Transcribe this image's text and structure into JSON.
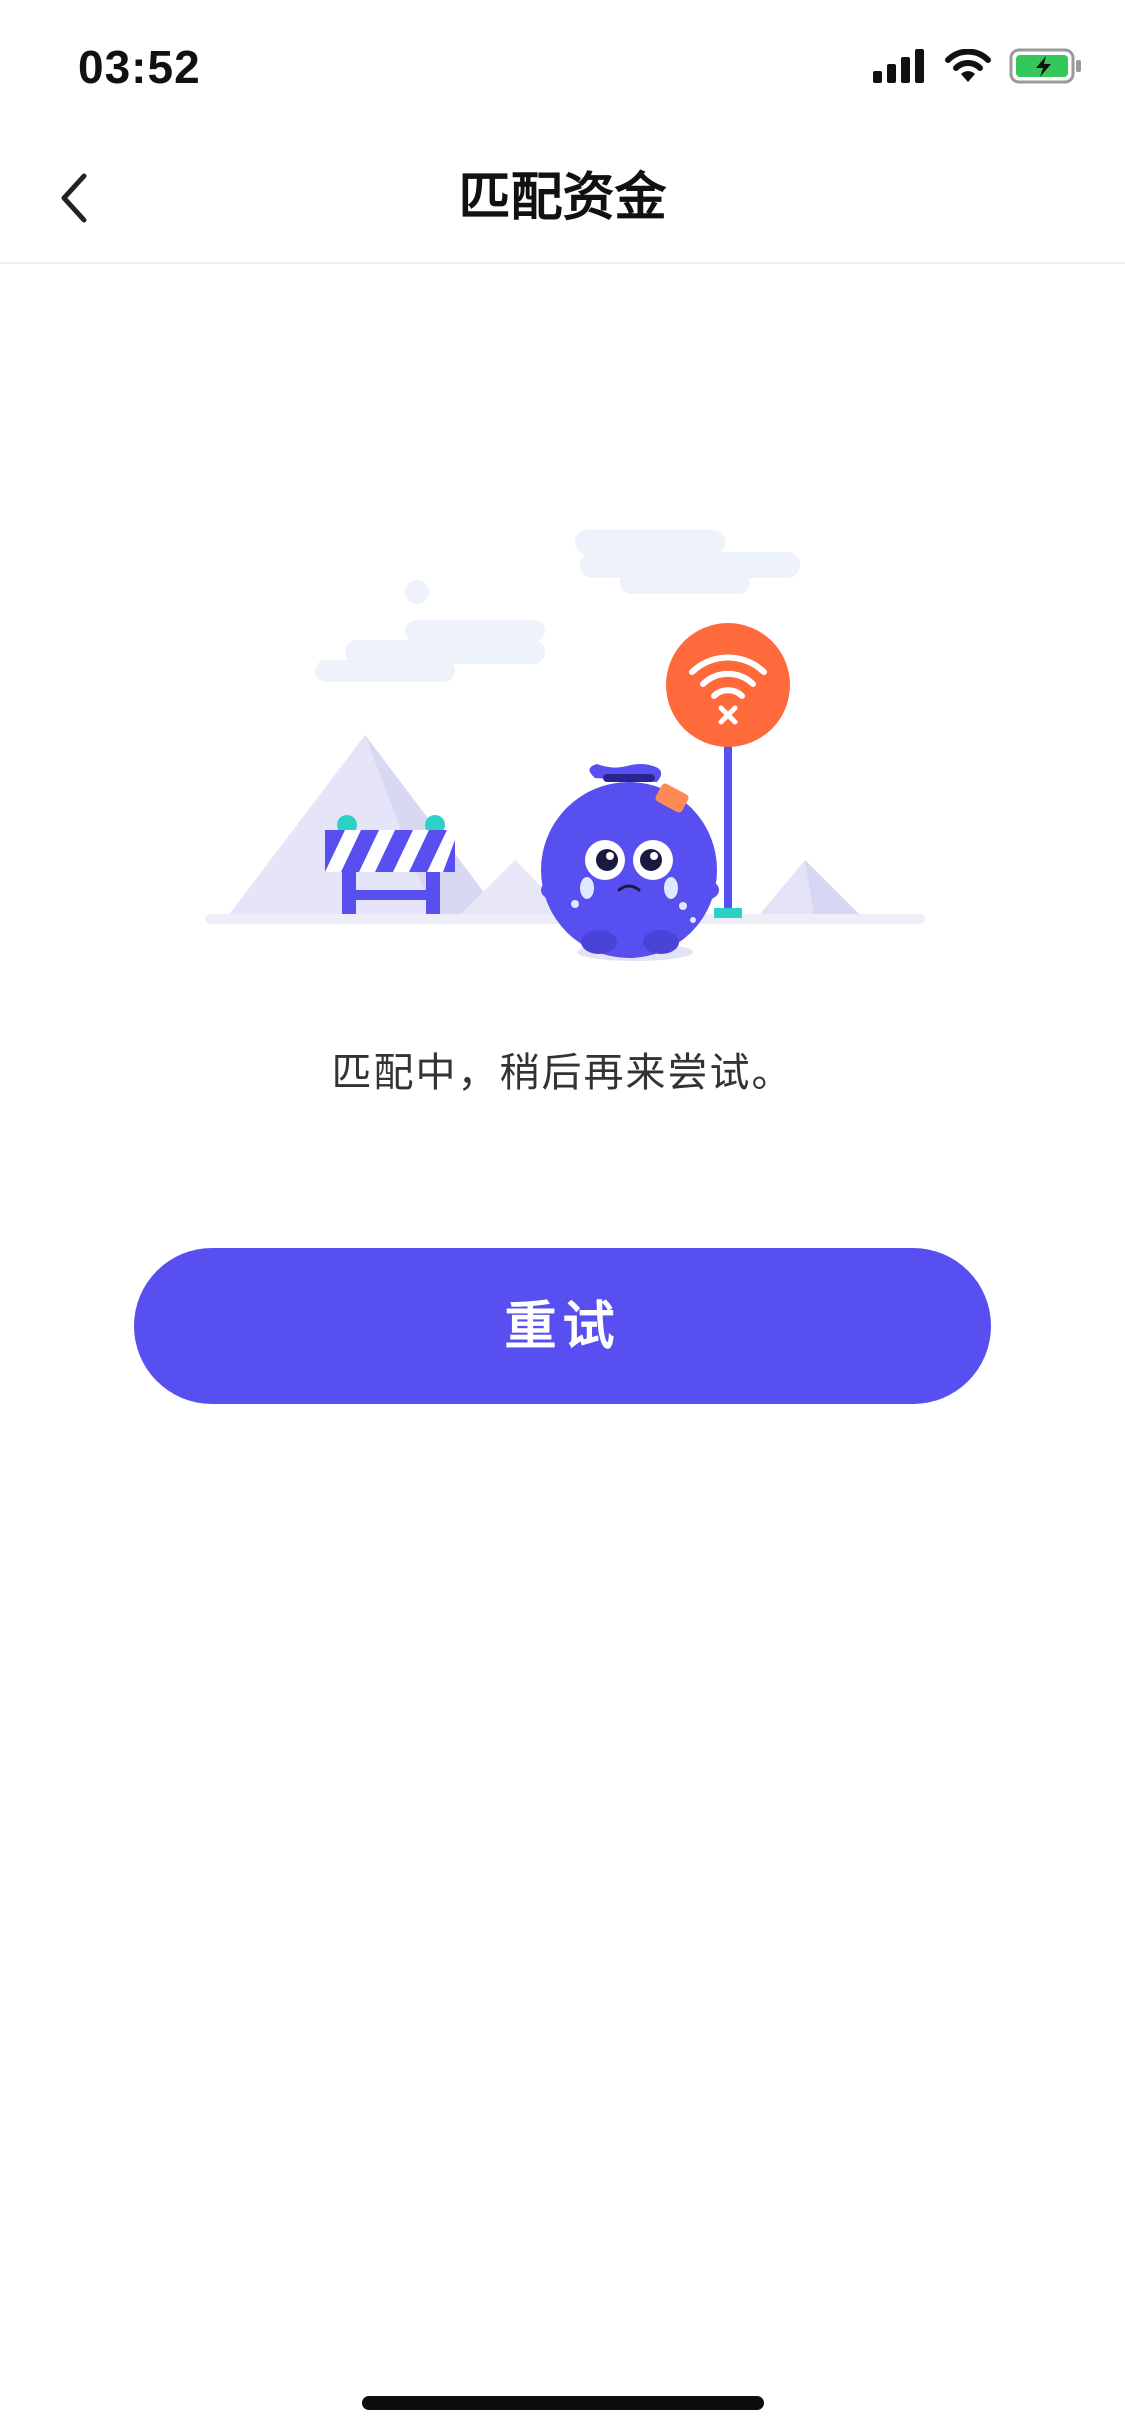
{
  "status_bar": {
    "time": "03:52",
    "icons": [
      "signal-icon",
      "wifi-icon",
      "battery-charging-icon"
    ]
  },
  "nav": {
    "title": "匹配资金",
    "back_icon": "chevron-left-icon"
  },
  "illustration": {
    "icons": [
      "mountain-icon",
      "barrier-icon",
      "mascot-icon",
      "no-wifi-sign-icon",
      "cloud-icon"
    ]
  },
  "main": {
    "message": "匹配中，稍后再来尝试。",
    "retry_label": "重试"
  },
  "colors": {
    "accent": "#574ff0",
    "sign": "#ff6a3d",
    "teal": "#2ad1c4",
    "mountain": "#e3e2f7",
    "cloud": "#eef3fb"
  }
}
